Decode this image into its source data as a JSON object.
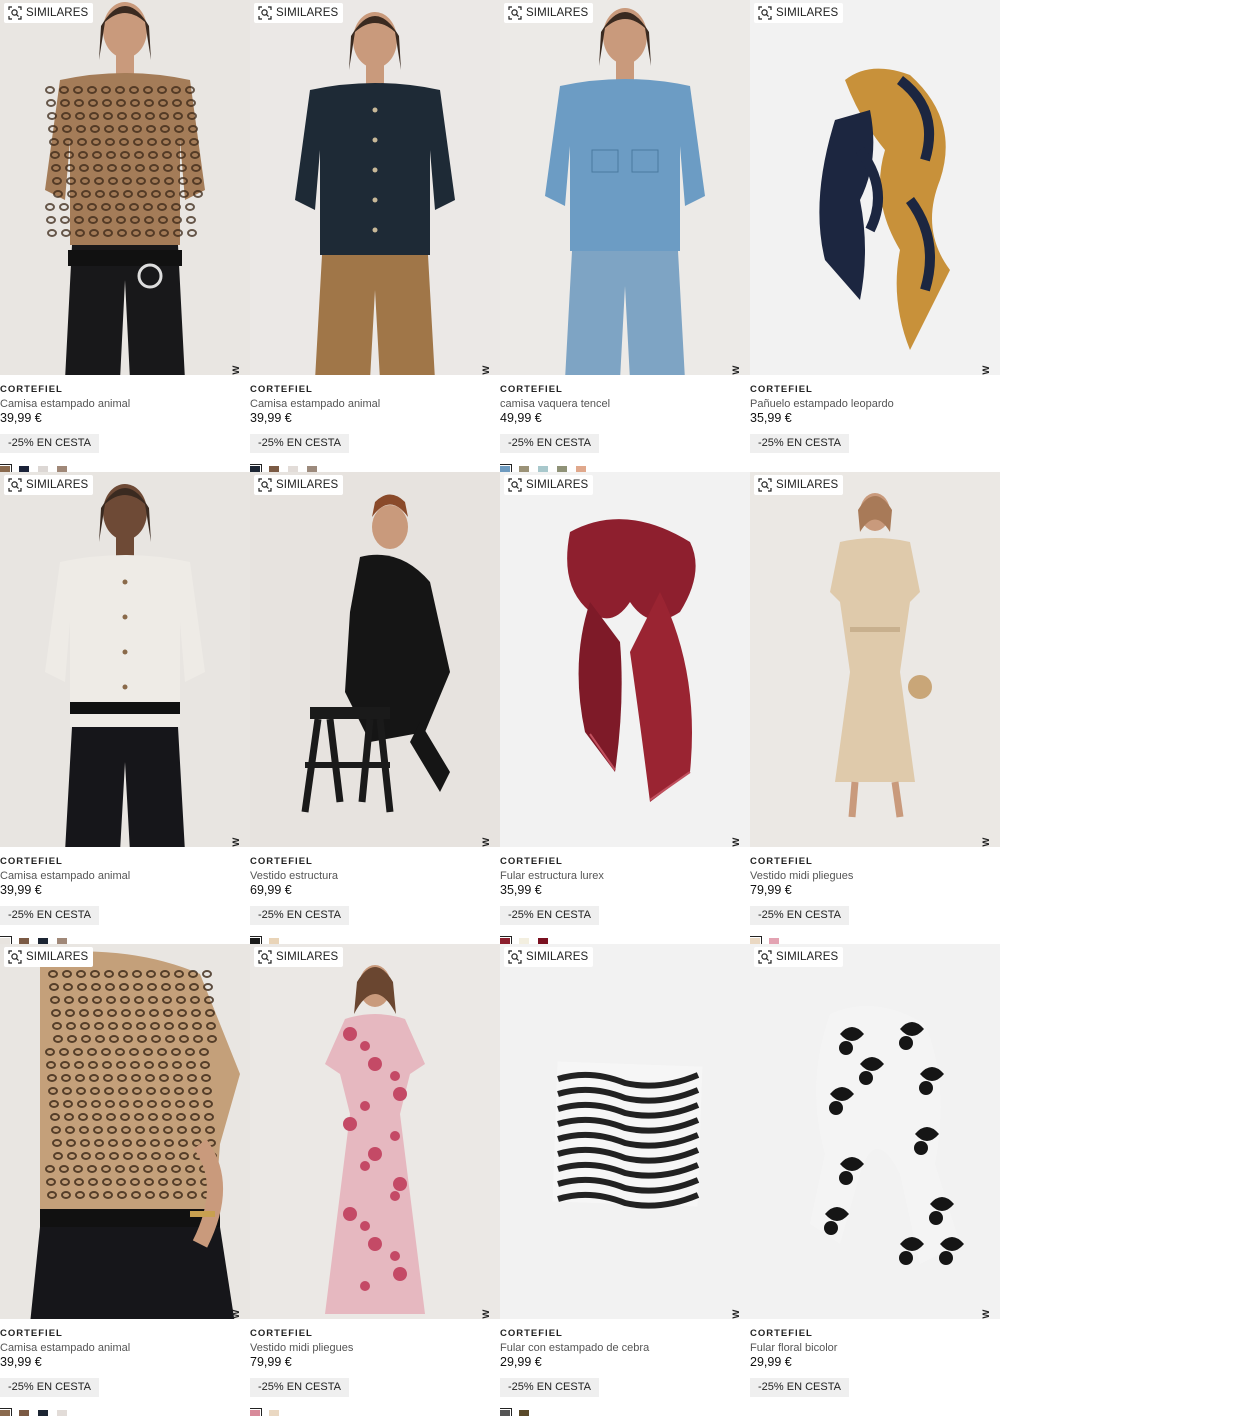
{
  "similar_label": "SIMILARES",
  "new_label": "NEW",
  "products": [
    {
      "brand": "CORTEFIEL",
      "name": "Camisa estampado animal",
      "price": "39,99 €",
      "promo": "-25% EN CESTA",
      "is_new": true,
      "bg": "#e9e6e2",
      "figure": "leopard-shirt-belt",
      "swatches": [
        "#8a6a4e",
        "#1a2238",
        "#dcd7d4",
        "#a08878"
      ]
    },
    {
      "brand": "CORTEFIEL",
      "name": "Camisa estampado animal",
      "price": "39,99 €",
      "promo": "-25% EN CESTA",
      "is_new": true,
      "bg": "#ebe8e6",
      "figure": "navy-shirt",
      "swatches": [
        "#1c2533",
        "#7b5a44",
        "#e2dcd8",
        "#9c8a7c"
      ]
    },
    {
      "brand": "CORTEFIEL",
      "name": "camisa vaquera tencel",
      "price": "49,99 €",
      "promo": "-25% EN CESTA",
      "is_new": true,
      "bg": "#eceae7",
      "figure": "denim-shirt",
      "swatches": [
        "#6e9bc0",
        "#9b9277",
        "#a8c8cc",
        "#8f9277",
        "#e0a88c"
      ]
    },
    {
      "brand": "CORTEFIEL",
      "name": "Pañuelo estampado leopardo",
      "price": "35,99 €",
      "promo": "-25% EN CESTA",
      "is_new": true,
      "bg": "#f2f2f2",
      "figure": "scarf-navy-gold",
      "swatches": []
    },
    {
      "brand": "CORTEFIEL",
      "name": "Camisa estampado animal",
      "price": "39,99 €",
      "promo": "-25% EN CESTA",
      "is_new": true,
      "bg": "#e8e5e1",
      "figure": "white-shirt",
      "swatches": [
        "#e8e4df",
        "#7b5a44",
        "#1c2533",
        "#a08878"
      ]
    },
    {
      "brand": "CORTEFIEL",
      "name": "Vestido estructura",
      "price": "69,99 €",
      "promo": "-25% EN CESTA",
      "is_new": true,
      "bg": "#e7e3df",
      "figure": "black-dress-stool",
      "swatches": [
        "#1a1a1a",
        "#e9d4b8"
      ]
    },
    {
      "brand": "CORTEFIEL",
      "name": "Fular estructura lurex",
      "price": "35,99 €",
      "promo": "-25% EN CESTA",
      "is_new": true,
      "bg": "#f2f2f2",
      "figure": "scarf-red",
      "swatches": [
        "#8c1f2d",
        "#f3efe0",
        "#7a1020"
      ]
    },
    {
      "brand": "CORTEFIEL",
      "name": "Vestido midi pliegues",
      "price": "79,99 €",
      "promo": "-25% EN CESTA",
      "is_new": true,
      "bg": "#ebe8e4",
      "figure": "beige-dress",
      "swatches": [
        "#ead8c2",
        "#e3a3b2"
      ]
    },
    {
      "brand": "CORTEFIEL",
      "name": "Camisa estampado animal",
      "price": "39,99 €",
      "promo": "-25% EN CESTA",
      "is_new": true,
      "bg": "#e9e6e2",
      "figure": "leopard-shirt-side",
      "swatches": [
        "#8a6a4e",
        "#7b5a44",
        "#1c2533",
        "#e2dcd8"
      ]
    },
    {
      "brand": "CORTEFIEL",
      "name": "Vestido midi pliegues",
      "price": "79,99 €",
      "promo": "-25% EN CESTA",
      "is_new": true,
      "bg": "#ebe8e5",
      "figure": "pink-dress",
      "swatches": [
        "#d88a9a",
        "#ead8c2"
      ]
    },
    {
      "brand": "CORTEFIEL",
      "name": "Fular con estampado de cebra",
      "price": "29,99 €",
      "promo": "-25% EN CESTA",
      "is_new": true,
      "bg": "#f2f2f2",
      "figure": "scarf-zebra",
      "swatches": [
        "#555555",
        "#5a4a2a"
      ]
    },
    {
      "brand": "CORTEFIEL",
      "name": "Fular floral bicolor",
      "price": "29,99 €",
      "promo": "-25% EN CESTA",
      "is_new": true,
      "bg": "#f2f2f2",
      "figure": "scarf-floral",
      "swatches": []
    }
  ]
}
